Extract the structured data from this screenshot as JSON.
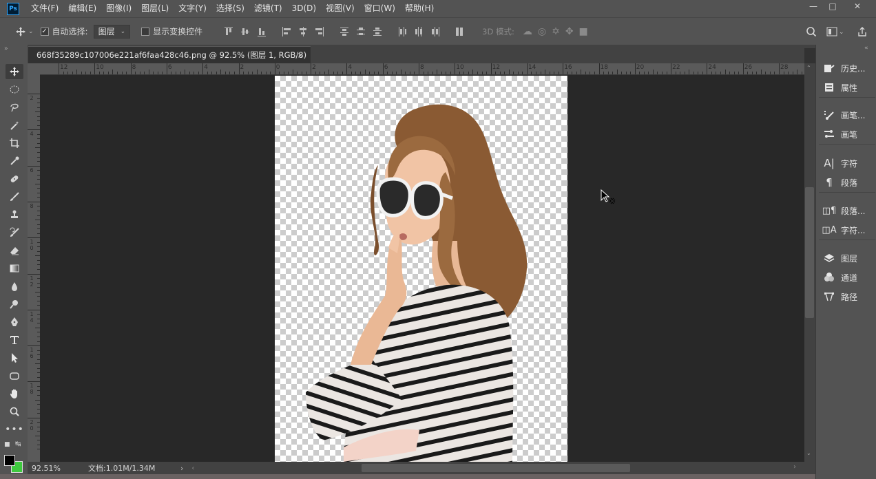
{
  "app": {
    "logo": "Ps"
  },
  "menu": [
    "文件(F)",
    "编辑(E)",
    "图像(I)",
    "图层(L)",
    "文字(Y)",
    "选择(S)",
    "滤镜(T)",
    "3D(D)",
    "视图(V)",
    "窗口(W)",
    "帮助(H)"
  ],
  "options": {
    "auto_select_label": "自动选择:",
    "auto_select_checked": true,
    "layer_select_value": "图层",
    "show_transform_label": "显示变换控件",
    "mode_3d_label": "3D 模式:"
  },
  "document_tab": {
    "title": "668f35289c107006e221af6faa428c46.png @ 92.5% (图层 1, RGB/8) *",
    "close": "×"
  },
  "ruler_top": [
    "12",
    "10",
    "8",
    "6",
    "4",
    "2",
    "0",
    "2",
    "4",
    "6",
    "8",
    "10",
    "12",
    "14",
    "16",
    "18",
    "20",
    "22",
    "24",
    "26",
    "28"
  ],
  "ruler_left": [
    "2",
    "4",
    "6",
    "8",
    "1 0",
    "1 2",
    "1 4",
    "1 6",
    "1 8",
    "2 0"
  ],
  "right_panel": [
    {
      "icon": "history-icon",
      "label": "历史..."
    },
    {
      "icon": "properties-icon",
      "label": "属性"
    },
    {
      "icon": "brush-presets-icon",
      "label": "画笔..."
    },
    {
      "icon": "brush-icon",
      "label": "画笔"
    },
    {
      "icon": "character-icon",
      "label": "字符"
    },
    {
      "icon": "paragraph-icon",
      "label": "段落"
    },
    {
      "icon": "paragraph-styles-icon",
      "label": "段落..."
    },
    {
      "icon": "character-styles-icon",
      "label": "字符..."
    },
    {
      "icon": "layers-icon",
      "label": "图层"
    },
    {
      "icon": "channels-icon",
      "label": "通道"
    },
    {
      "icon": "paths-icon",
      "label": "路径"
    }
  ],
  "status": {
    "zoom": "92.51%",
    "doc_info": "文档:1.01M/1.34M"
  },
  "colors": {
    "foreground": "#000000",
    "background": "#3ec93e"
  }
}
